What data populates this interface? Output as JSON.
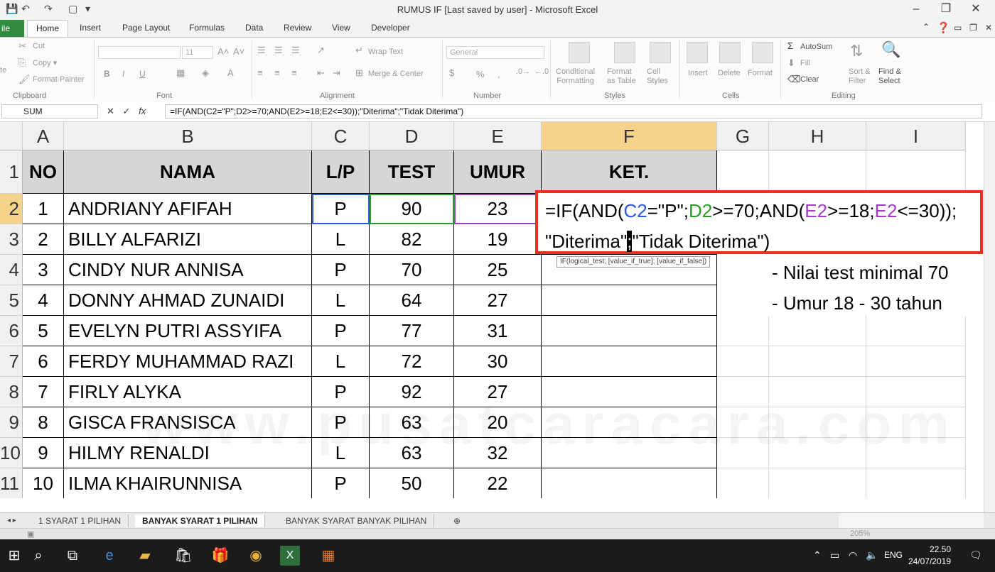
{
  "window": {
    "title": "RUMUS IF [Last saved by user]  -  Microsoft Excel",
    "controls": [
      "–",
      "❐",
      "✕"
    ]
  },
  "ribbon_tabs": [
    "ile",
    "Home",
    "Insert",
    "Page Layout",
    "Formulas",
    "Data",
    "Review",
    "View",
    "Developer"
  ],
  "ribbon": {
    "clipboard": {
      "cut": "Cut",
      "copy": "Copy ▾",
      "format_painter": "Format Painter",
      "paste": "te",
      "group": "Clipboard"
    },
    "font": {
      "size": "11",
      "bold": "B",
      "italic": "I",
      "underline": "U",
      "grow": "A˄",
      "shrink": "A˅",
      "group": "Font"
    },
    "alignment": {
      "wrap_text": "Wrap Text",
      "merge_center": "Merge & Center",
      "group": "Alignment"
    },
    "number": {
      "format": "General",
      "percent": "%",
      "comma": ",",
      "group": "Number"
    },
    "styles": {
      "conditional": "Conditional\nFormatting",
      "format_table": "Format\nas Table",
      "cell_styles": "Cell\nStyles",
      "group": "Styles"
    },
    "cells": {
      "insert": "Insert",
      "delete": "Delete",
      "format": "Format",
      "group": "Cells"
    },
    "editing": {
      "autosum": "AutoSum",
      "fill": "Fill",
      "clear": "Clear",
      "sort_filter": "Sort &\nFilter",
      "find_select": "Find &\nSelect",
      "group": "Editing"
    }
  },
  "formula_bar": {
    "name_box": "SUM",
    "formula": "=IF(AND(C2=\"P\";D2>=70;AND(E2>=18;E2<=30));\"Diterima\";\"Tidak Diterima\")"
  },
  "columns": [
    "A",
    "B",
    "C",
    "D",
    "E",
    "F",
    "G",
    "H",
    "I"
  ],
  "rows": [
    "1",
    "2",
    "3",
    "4",
    "5",
    "6",
    "7",
    "8",
    "9",
    "10",
    "11"
  ],
  "table": {
    "headers": [
      "NO",
      "NAMA",
      "L/P",
      "TEST",
      "UMUR",
      "KET."
    ],
    "rows": [
      [
        "1",
        "ANDRIANY AFIFAH",
        "P",
        "90",
        "23"
      ],
      [
        "2",
        "BILLY ALFARIZI",
        "L",
        "82",
        "19"
      ],
      [
        "3",
        "CINDY NUR ANNISA",
        "P",
        "70",
        "25"
      ],
      [
        "4",
        "DONNY AHMAD ZUNAIDI",
        "L",
        "64",
        "27"
      ],
      [
        "5",
        "EVELYN PUTRI ASSYIFA",
        "P",
        "77",
        "31"
      ],
      [
        "6",
        "FERDY MUHAMMAD RAZI",
        "L",
        "72",
        "30"
      ],
      [
        "7",
        "FIRLY ALYKA",
        "P",
        "92",
        "27"
      ],
      [
        "8",
        "GISCA FRANSISCA",
        "P",
        "63",
        "20"
      ],
      [
        "9",
        "HILMY RENALDI",
        "L",
        "63",
        "32"
      ],
      [
        "10",
        "ILMA KHAIRUNNISA",
        "P",
        "50",
        "22"
      ]
    ]
  },
  "edit": {
    "l1_a": "=IF(AND(",
    "l1_c2": "C2",
    "l1_b": "=\"P\";",
    "l1_d2": "D2",
    "l1_c": ">=70;AND(",
    "l1_e2a": "E2",
    "l1_d": ">=18;",
    "l1_e2b": "E2",
    "l1_e": "<=30));",
    "l2_a": "\"Diterima\"",
    "l2_sep": ";",
    "l2_b": "\"Tidak Diterima\")",
    "tooltip": "IF(logical_test; [value_if_true]; [value_if_false])"
  },
  "notes": [
    "- Nilai test minimal 70",
    "- Umur 18 - 30 tahun"
  ],
  "watermark": "www.pusatcaracara.com",
  "sheet_tabs": [
    "1 SYARAT 1 PILIHAN",
    "BANYAK SYARAT 1 PILIHAN",
    "BANYAK SYARAT BANYAK PILIHAN"
  ],
  "status": {
    "zoom": "205%"
  },
  "taskbar": {
    "lang": "ENG",
    "time": "22.50",
    "date": "24/07/2019"
  },
  "colors": {
    "file_tab": "#2f8a3d",
    "selected_header": "#f6d38b",
    "edit_border": "#e8321f",
    "ref_c2": "#2b57d9",
    "ref_d2": "#2a9a2a",
    "ref_e2": "#a23cc6"
  }
}
